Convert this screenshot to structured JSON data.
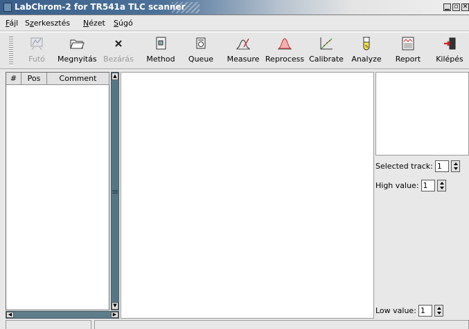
{
  "window": {
    "title": "LabChrom-2 for TR541a TLC scanner"
  },
  "menu": {
    "items": [
      {
        "label_u": "F",
        "label_rest": "ájl"
      },
      {
        "label_u": "",
        "label_pre": "S",
        "label_u2": "z",
        "label_rest": "erkesztés"
      },
      {
        "label_u": "N",
        "label_rest": "ézet"
      },
      {
        "label_u": "S",
        "label_rest": "úgó"
      }
    ]
  },
  "toolbar": {
    "futo": "Futó",
    "megnyitas": "Megnyitás",
    "bezaras": "Bezárás",
    "method": "Method",
    "queue": "Queue",
    "measure": "Measure",
    "reprocess": "Reprocess",
    "calibrate": "Calibrate",
    "analyze": "Analyze",
    "report": "Report",
    "kilepes": "Kilépés"
  },
  "table": {
    "columns": [
      "#",
      "Pos",
      "Comment"
    ]
  },
  "right_panel": {
    "selected_track_label": "Selected track:",
    "selected_track_value": "1",
    "high_value_label": "High value:",
    "high_value_value": "1",
    "low_value_label": "Low value:",
    "low_value_value": "1"
  },
  "colors": {
    "titlebar": "#3a5f8a",
    "scrollbar": "#5d7d8a"
  }
}
